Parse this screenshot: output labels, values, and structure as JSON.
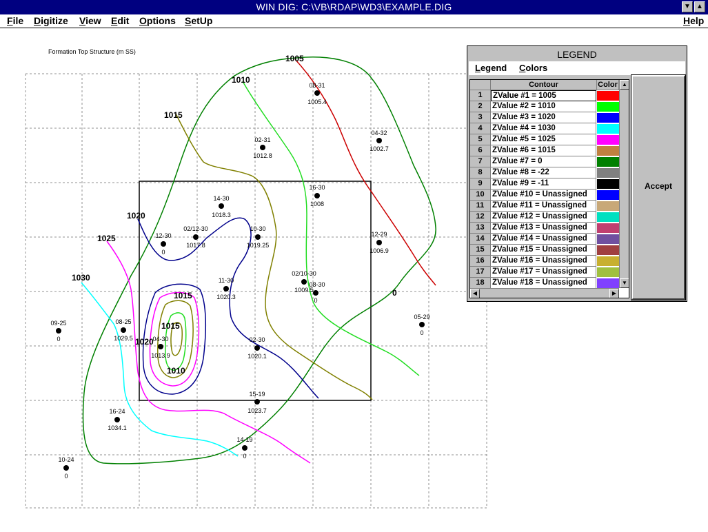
{
  "window": {
    "title": "WIN DIG: C:\\VB\\RDAP\\WD3\\EXAMPLE.DIG"
  },
  "menu": [
    {
      "u": "F",
      "rest": "ile"
    },
    {
      "u": "D",
      "rest": "igitize"
    },
    {
      "u": "V",
      "rest": "iew"
    },
    {
      "u": "E",
      "rest": "dit"
    },
    {
      "u": "O",
      "rest": "ptions"
    },
    {
      "u": "S",
      "rest": "etUp"
    },
    {
      "u": "H",
      "rest": "elp"
    }
  ],
  "map": {
    "title": "Formation Top Structure (m SS)",
    "wells": [
      {
        "name": "08-31",
        "value": "1005.4"
      },
      {
        "name": "04-32",
        "value": "1002.7"
      },
      {
        "name": "02-31",
        "value": "1012.8"
      },
      {
        "name": "16-30",
        "value": "1008"
      },
      {
        "name": "14-30",
        "value": "1018.3"
      },
      {
        "name": "12-30",
        "value": "0"
      },
      {
        "name": "02/12-30",
        "value": "1017.8"
      },
      {
        "name": "10-30",
        "value": "1019.25"
      },
      {
        "name": "12-29",
        "value": "1006.9"
      },
      {
        "name": "02/10-30",
        "value": "1009.5"
      },
      {
        "name": "08-30",
        "value": "0"
      },
      {
        "name": "11-30",
        "value": "1020.3"
      },
      {
        "name": "09-25",
        "value": "0"
      },
      {
        "name": "08-25",
        "value": "1029.5"
      },
      {
        "name": "04-30",
        "value": "1013.9"
      },
      {
        "name": "02-30",
        "value": "1020.1"
      },
      {
        "name": "05-29",
        "value": "0"
      },
      {
        "name": "15-19",
        "value": "1023.7"
      },
      {
        "name": "16-24",
        "value": "1034.1"
      },
      {
        "name": "14-19",
        "value": "0"
      },
      {
        "name": "10-24",
        "value": "0"
      }
    ],
    "contour_labels": [
      "1005",
      "1010",
      "1015",
      "1020",
      "1025",
      "1030",
      "1015",
      "1015",
      "1020",
      "1010",
      "0"
    ]
  },
  "legend": {
    "title": "LEGEND",
    "menu": [
      {
        "u": "L",
        "rest": "egend"
      },
      {
        "u": "C",
        "rest": "olors"
      }
    ],
    "col_contour": "Contour",
    "col_color": "Color",
    "accept": "Accept",
    "rows": [
      {
        "num": "1",
        "label": "ZValue #1 = 1005",
        "color": "#ff0000"
      },
      {
        "num": "2",
        "label": "ZValue #2 = 1010",
        "color": "#00ff00"
      },
      {
        "num": "3",
        "label": "ZValue #3 = 1020",
        "color": "#0000ff"
      },
      {
        "num": "4",
        "label": "ZValue #4 = 1030",
        "color": "#00ffff"
      },
      {
        "num": "5",
        "label": "ZValue #5 = 1025",
        "color": "#ff00ff"
      },
      {
        "num": "6",
        "label": "ZValue #6 = 1015",
        "color": "#c08040"
      },
      {
        "num": "7",
        "label": "ZValue #7 = 0",
        "color": "#008000"
      },
      {
        "num": "8",
        "label": "ZValue #8 = -22",
        "color": "#808080"
      },
      {
        "num": "9",
        "label": "ZValue #9 = -11",
        "color": "#000000"
      },
      {
        "num": "10",
        "label": "ZValue #10 = Unassigned",
        "color": "#0000ff"
      },
      {
        "num": "11",
        "label": "ZValue #11 = Unassigned",
        "color": "#c8a878"
      },
      {
        "num": "12",
        "label": "ZValue #12 = Unassigned",
        "color": "#00e0c0"
      },
      {
        "num": "13",
        "label": "ZValue #13 = Unassigned",
        "color": "#c04070"
      },
      {
        "num": "14",
        "label": "ZValue #14 = Unassigned",
        "color": "#7050a0"
      },
      {
        "num": "15",
        "label": "ZValue #15 = Unassigned",
        "color": "#a04040"
      },
      {
        "num": "16",
        "label": "ZValue #16 = Unassigned",
        "color": "#c8b030"
      },
      {
        "num": "17",
        "label": "ZValue #17 = Unassigned",
        "color": "#a0c040"
      },
      {
        "num": "18",
        "label": "ZValue #18 = Unassigned",
        "color": "#8040ff"
      }
    ]
  }
}
